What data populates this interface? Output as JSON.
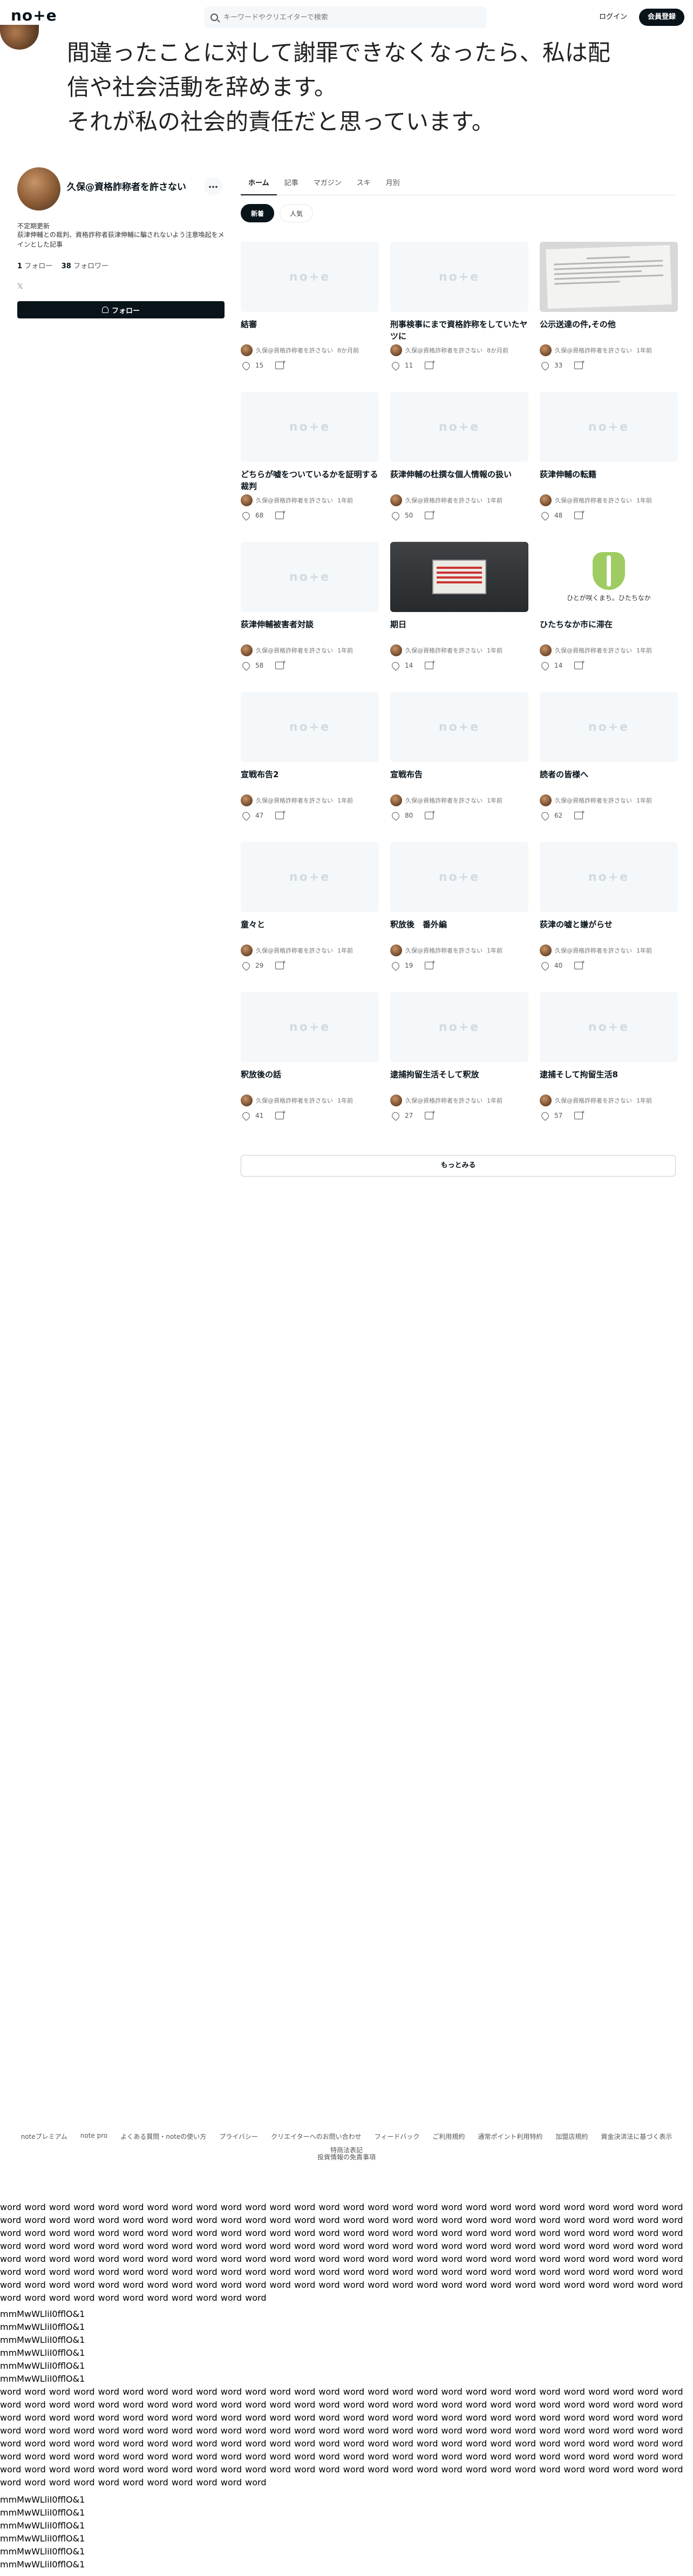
{
  "header": {
    "logo": "no+e",
    "search_placeholder": "キーワードやクリエイターで検索",
    "login": "ログイン",
    "signup": "会員登録"
  },
  "banner": {
    "lines": [
      "間違ったことに対して謝罪できなくなったら、私は配",
      "信や社会活動を辞めます。",
      "それが私の社会的責任だと思っています。"
    ]
  },
  "profile": {
    "name": "久保@資格詐称者を許さない",
    "more": "…",
    "tag": "不定期更新",
    "bio": "荻津伸輔との裁判、資格詐称者荻津伸輔に騙されないよう注意喚起をメインとした記事",
    "following_count": "1",
    "following_label": "フォロー",
    "followers_count": "38",
    "followers_label": "フォロワー",
    "x_icon": "𝕏",
    "follow_button": "フォロー"
  },
  "tabs": [
    "ホーム",
    "記事",
    "マガジン",
    "スキ",
    "月別"
  ],
  "filters": [
    "新着",
    "人気"
  ],
  "cards": [
    {
      "title": "結審",
      "author": "久保@資格詐称者を許さない",
      "time": "8か月前",
      "likes": "15",
      "thumb": "logo"
    },
    {
      "title": "刑事検事にまで資格詐称をしていたヤツに",
      "author": "久保@資格詐称者を許さない",
      "time": "8か月前",
      "likes": "11",
      "thumb": "logo"
    },
    {
      "title": "公示送達の件,その他",
      "author": "久保@資格詐称者を許さない",
      "time": "1年前",
      "likes": "33",
      "thumb": "doc"
    },
    {
      "title": "どちらが嘘をついているかを証明する裁判",
      "author": "久保@資格詐称者を許さない",
      "time": "1年前",
      "likes": "68",
      "thumb": "logo"
    },
    {
      "title": "荻津伸輔の杜撰な個人情報の扱い",
      "author": "久保@資格詐称者を許さない",
      "time": "1年前",
      "likes": "50",
      "thumb": "logo"
    },
    {
      "title": "荻津伸輔の転籍",
      "author": "久保@資格詐称者を許さない",
      "time": "1年前",
      "likes": "48",
      "thumb": "logo"
    },
    {
      "title": "荻津伸輔被害者対談",
      "author": "久保@資格詐称者を許さない",
      "time": "1年前",
      "likes": "58",
      "thumb": "logo"
    },
    {
      "title": "期日",
      "author": "久保@資格詐称者を許さない",
      "time": "1年前",
      "likes": "14",
      "thumb": "sign"
    },
    {
      "title": "ひたちなか市に滞在",
      "author": "久保@資格詐称者を許さない",
      "time": "1年前",
      "likes": "14",
      "thumb": "city",
      "thumb_caption": "ひとが咲くまち。ひたちなか"
    },
    {
      "title": "宣戦布告2",
      "author": "久保@資格詐称者を許さない",
      "time": "1年前",
      "likes": "47",
      "thumb": "logo"
    },
    {
      "title": "宣戦布告",
      "author": "久保@資格詐称者を許さない",
      "time": "1年前",
      "likes": "80",
      "thumb": "logo"
    },
    {
      "title": "読者の皆様へ",
      "author": "久保@資格詐称者を許さない",
      "time": "1年前",
      "likes": "62",
      "thumb": "logo"
    },
    {
      "title": "童々と",
      "author": "久保@資格詐称者を許さない",
      "time": "1年前",
      "likes": "29",
      "thumb": "logo"
    },
    {
      "title": "釈放後　番外編",
      "author": "久保@資格詐称者を許さない",
      "time": "1年前",
      "likes": "19",
      "thumb": "logo"
    },
    {
      "title": "荻津の嘘と嫌がらせ",
      "author": "久保@資格詐称者を許さない",
      "time": "1年前",
      "likes": "40",
      "thumb": "logo"
    },
    {
      "title": "釈放後の話",
      "author": "久保@資格詐称者を許さない",
      "time": "1年前",
      "likes": "41",
      "thumb": "logo"
    },
    {
      "title": "逮捕拘留生活そして釈放",
      "author": "久保@資格詐称者を許さない",
      "time": "1年前",
      "likes": "27",
      "thumb": "logo"
    },
    {
      "title": "逮捕そして拘留生活8",
      "author": "久保@資格詐称者を許さない",
      "time": "1年前",
      "likes": "57",
      "thumb": "logo"
    }
  ],
  "more_button": "もっとみる",
  "footer": {
    "links": [
      "noteプレミアム",
      "note pro",
      "よくある質問・noteの使い方",
      "プライバシー",
      "クリエイターへのお問い合わせ",
      "フィードバック",
      "ご利用規約",
      "通常ポイント利用特約",
      "加盟店規約",
      "資金決済法に基づく表示",
      "特商法表記"
    ],
    "link2": "投資情報の免責事項"
  },
  "text_test": {
    "words": "word word word word word word word word word word word word word word word word word word word word word word word word word word word word word word word word word word word word word word word word word word word word word word word word word word word word word word word word word word word word word word word word word word word word word word word word word word word word word word word word word word word word word word word word word word word word word word word word word word word word word word word word word word word word word word word word word word word word word word word word word word word word word word word word word word word word word word word word word word word word word word word word word word word word word word word word word word word word word word word word word word word word word word word word word word word word word word word word word word word word word word word word word word word word word word word word word word word word word word word word word word word word word word word",
    "glyph_lines": [
      "mmMwWLliI0fflO&1",
      "mmMwWLliI0fflO&1",
      "mmMwWLliI0fflO&1",
      "mmMwWLliI0fflO&1",
      "mmMwWLliI0fflO&1"
    ],
    "glyph_single": "mmMwWLliI0fflO&1"
  }
}
